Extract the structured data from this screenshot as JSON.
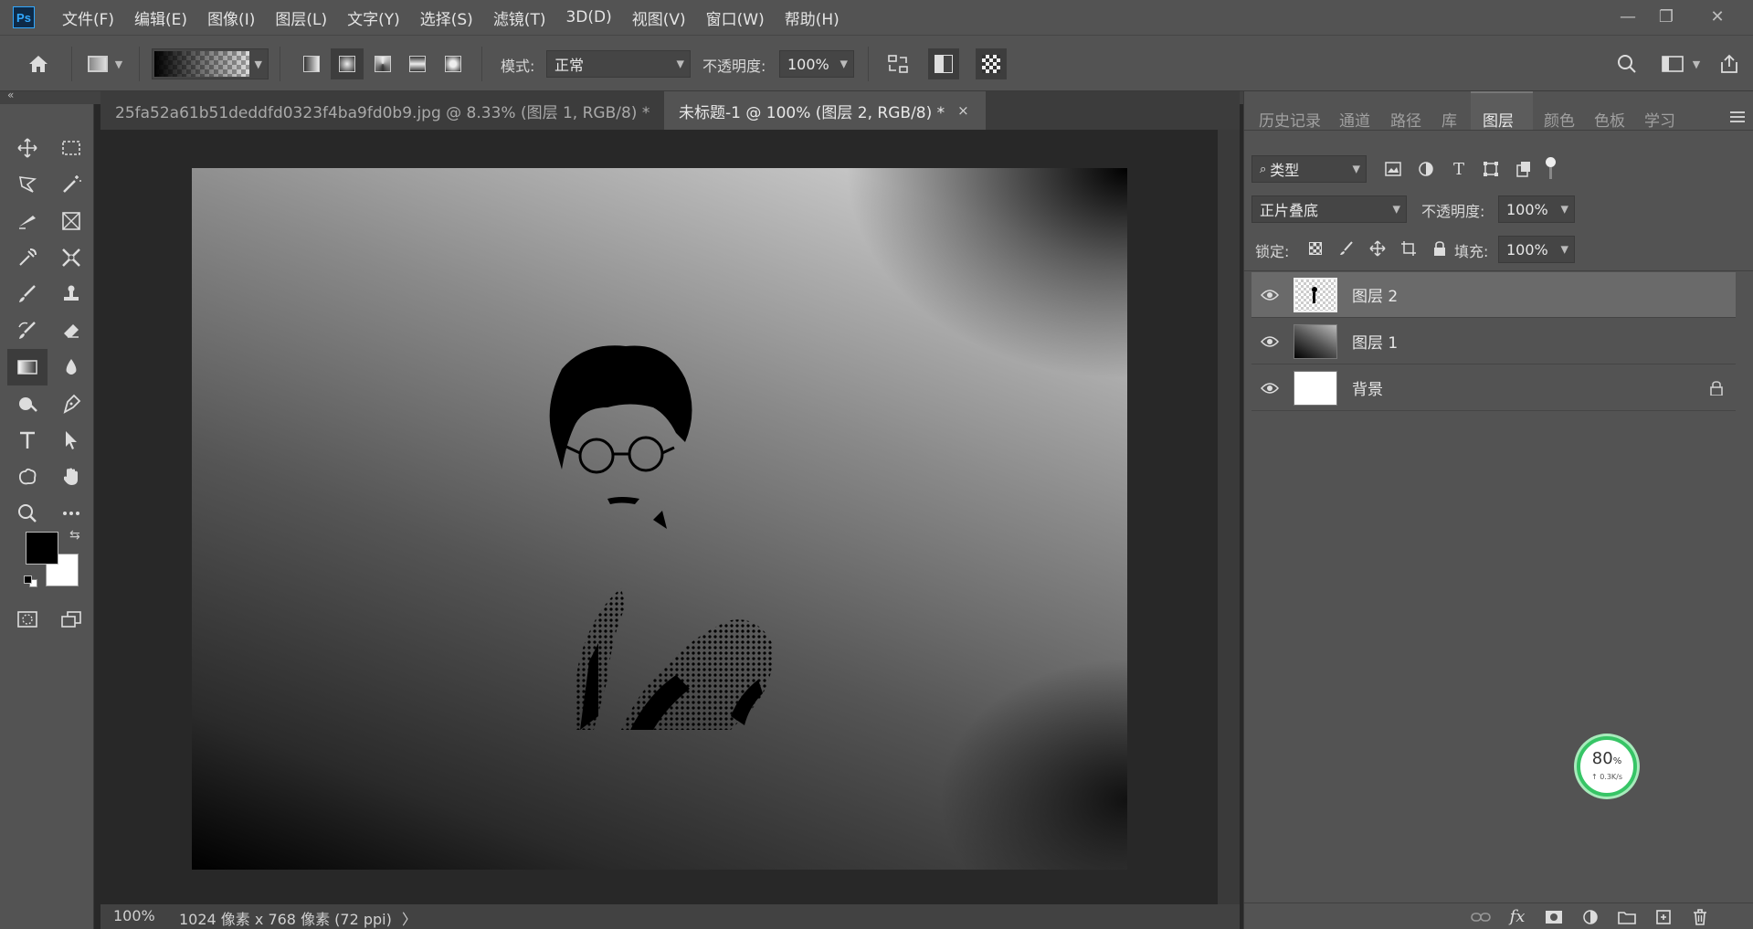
{
  "app": {
    "logo": "Ps"
  },
  "menu": [
    "文件(F)",
    "编辑(E)",
    "图像(I)",
    "图层(L)",
    "文字(Y)",
    "选择(S)",
    "滤镜(T)",
    "3D(D)",
    "视图(V)",
    "窗口(W)",
    "帮助(H)"
  ],
  "window_controls": {
    "minimize": "—",
    "restore": "❐",
    "close": "✕"
  },
  "options": {
    "mode_label": "模式:",
    "mode_value": "正常",
    "opacity_label": "不透明度:",
    "opacity_value": "100%"
  },
  "tabs": [
    {
      "label": "25fa52a61b51deddfd0323f4ba9fd0b9.jpg @ 8.33% (图层 1, RGB/8) *",
      "close": "×"
    },
    {
      "label": "未标题-1 @ 100% (图层 2, RGB/8) *",
      "close": "×"
    }
  ],
  "panel_tabs": [
    "历史记录",
    "通道",
    "路径",
    "库",
    "图层",
    "颜色",
    "色板",
    "学习"
  ],
  "layers_panel": {
    "filter_label": "类型",
    "blend_mode": "正片叠底",
    "opacity_label": "不透明度:",
    "opacity_value": "100%",
    "lock_label": "锁定:",
    "fill_label": "填充:",
    "fill_value": "100%",
    "layers": [
      {
        "name": "图层 2",
        "selected": true
      },
      {
        "name": "图层 1",
        "selected": false
      },
      {
        "name": "背景",
        "selected": false,
        "locked": true
      }
    ]
  },
  "status": {
    "zoom": "100%",
    "doc_info": "1024 像素 x 768 像素 (72 ppi)",
    "arrow": "〉"
  },
  "net_widget": {
    "percent": "80",
    "unit": "%",
    "speed": "↑ 0.3K/s"
  },
  "colors": {
    "foreground": "#000000",
    "background": "#ffffff",
    "accent": "#31a8ff"
  }
}
